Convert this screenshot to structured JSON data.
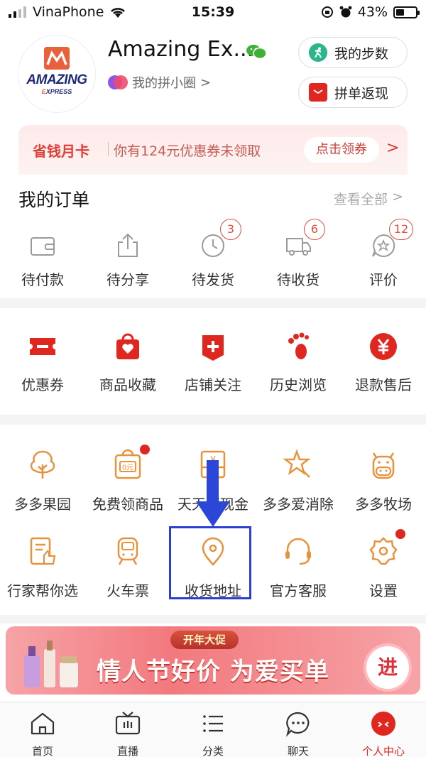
{
  "status": {
    "carrier": "VinaPhone",
    "time": "15:39",
    "battery": "43%",
    "battery_level": 0.43
  },
  "profile": {
    "avatar_text_1": "AMAZING",
    "avatar_text_2a": "E",
    "avatar_text_2b": "XPRESS",
    "name": "Amazing Ex...",
    "circle_label": "我的拼小圈",
    "circle_chevron": ">",
    "steps_label": "我的步数",
    "cashback_label": "拼单返现"
  },
  "savecard": {
    "title": "省钱月卡",
    "desc": "你有124元优惠券未领取",
    "button": "点击领券",
    "chevron": ">"
  },
  "orders": {
    "title": "我的订单",
    "view_all": "查看全部",
    "view_all_chevron": ">",
    "items": [
      {
        "label": "待付款",
        "icon": "wallet-icon",
        "count": ""
      },
      {
        "label": "待分享",
        "icon": "share-icon",
        "count": ""
      },
      {
        "label": "待发货",
        "icon": "clock-icon",
        "count": "3"
      },
      {
        "label": "待收货",
        "icon": "truck-icon",
        "count": "6"
      },
      {
        "label": "评价",
        "icon": "review-icon",
        "count": "12"
      }
    ]
  },
  "shortcuts": [
    {
      "label": "优惠券",
      "icon": "coupon-icon"
    },
    {
      "label": "商品收藏",
      "icon": "favorite-bag-icon"
    },
    {
      "label": "店铺关注",
      "icon": "store-follow-icon"
    },
    {
      "label": "历史浏览",
      "icon": "footprint-icon"
    },
    {
      "label": "退款售后",
      "icon": "refund-icon"
    }
  ],
  "services_row1": [
    {
      "label": "多多果园",
      "icon": "tree-icon"
    },
    {
      "label": "免费领商品",
      "icon": "free-goods-icon",
      "badge_text": "0元"
    },
    {
      "label": "天天领现金",
      "icon": "cash-icon",
      "badge_text": "¥"
    },
    {
      "label": "多多爱消除",
      "icon": "star-icon"
    },
    {
      "label": "多多牧场",
      "icon": "cow-icon"
    }
  ],
  "services_row2": [
    {
      "label": "行家帮你选",
      "icon": "expert-pick-icon"
    },
    {
      "label": "火车票",
      "icon": "train-icon"
    },
    {
      "label": "收货地址",
      "icon": "location-pin-icon"
    },
    {
      "label": "官方客服",
      "icon": "headset-icon"
    },
    {
      "label": "设置",
      "icon": "gear-icon"
    }
  ],
  "promo": {
    "tag": "开年大促",
    "headline": "情人节好价 为爱买单",
    "go": "进"
  },
  "tabbar": [
    {
      "label": "首页",
      "icon": "home-icon"
    },
    {
      "label": "直播",
      "icon": "tv-icon"
    },
    {
      "label": "分类",
      "icon": "menu-icon"
    },
    {
      "label": "聊天",
      "icon": "chat-icon"
    },
    {
      "label": "个人中心",
      "icon": "profile-icon"
    }
  ],
  "colors": {
    "accent": "#e0271f",
    "orange_icon": "#e8923c",
    "annotation_blue": "#2b3fd1"
  }
}
